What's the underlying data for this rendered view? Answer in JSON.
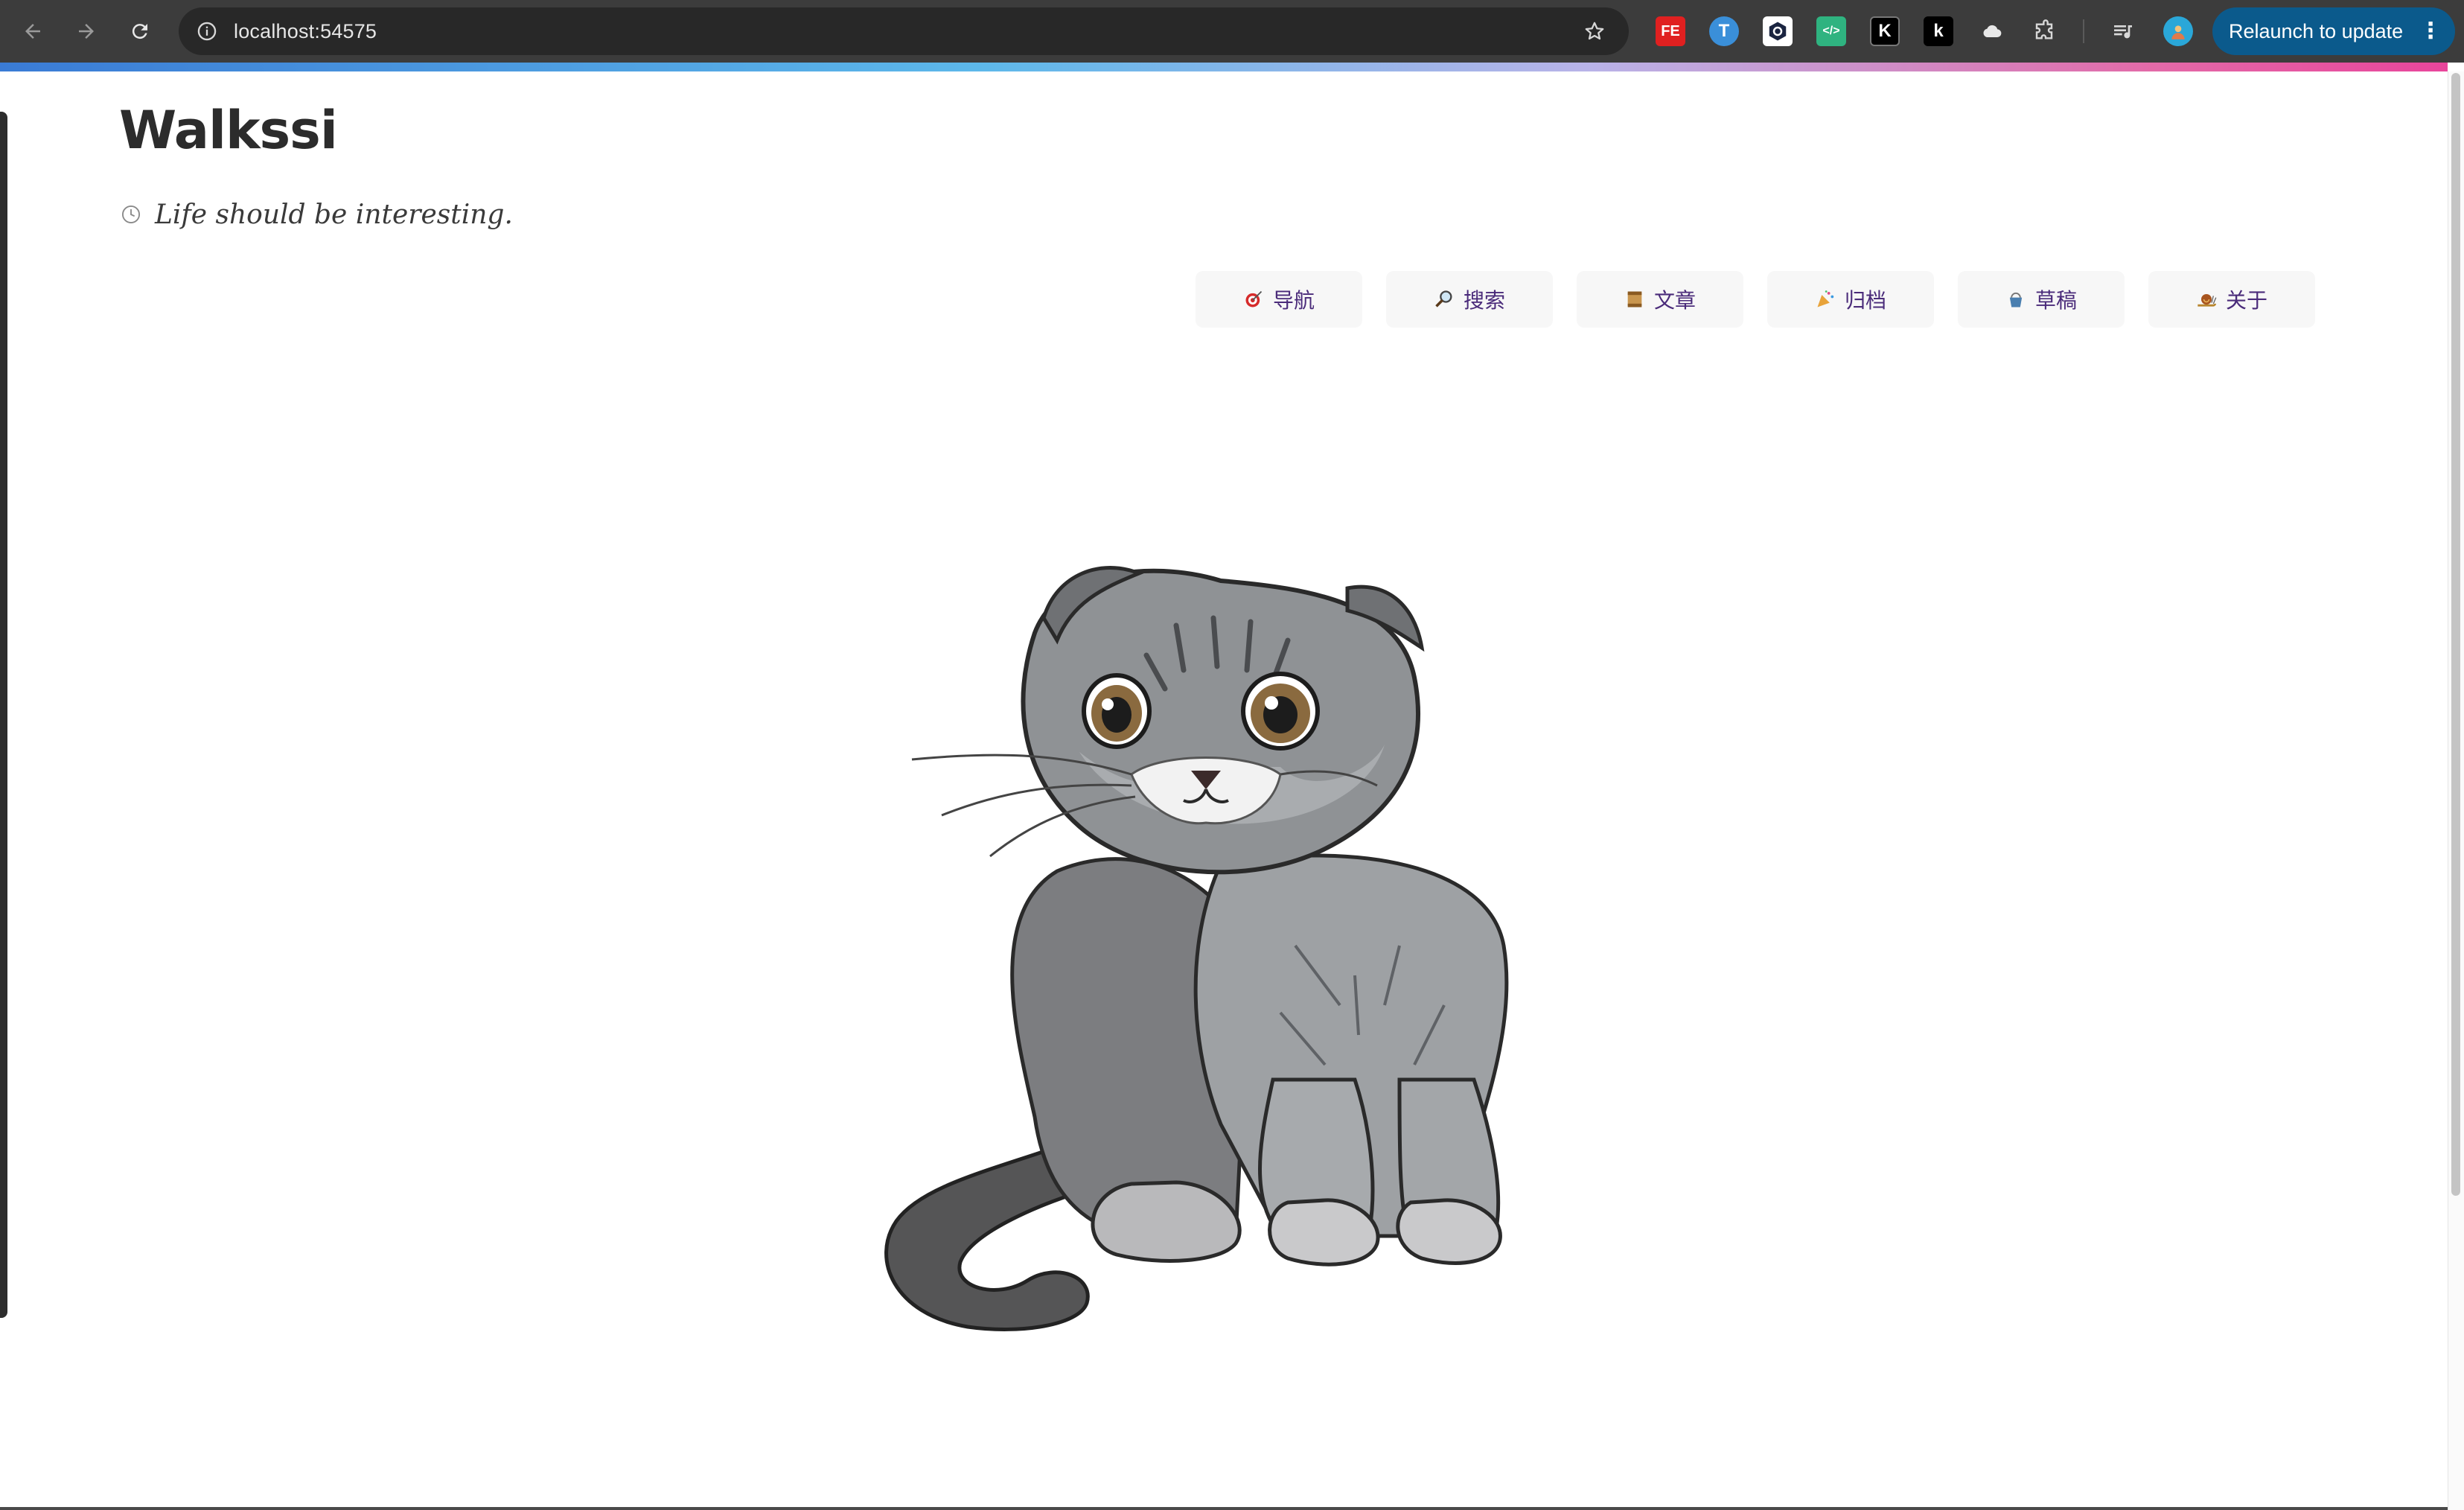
{
  "browser": {
    "url": "localhost:54575",
    "relaunch_label": "Relaunch to update",
    "extensions": [
      {
        "name": "fe-helper",
        "label": "FE",
        "color": "#e02020"
      },
      {
        "name": "translate",
        "label": "T",
        "color": "#3a8fd9"
      },
      {
        "name": "hex-tool",
        "label": "",
        "color": "#ffffff"
      },
      {
        "name": "code-viewer",
        "label": "</>",
        "color": "#2fb380"
      },
      {
        "name": "k-outline",
        "label": "K",
        "color": "#000000"
      },
      {
        "name": "k-solid",
        "label": "k",
        "color": "#000000"
      },
      {
        "name": "cloud",
        "label": "",
        "color": "#ffffff"
      }
    ]
  },
  "site": {
    "title": "Walkssi",
    "motto": "Life should be interesting."
  },
  "menu": [
    {
      "id": "nav",
      "emoji": "target-icon",
      "label": "导航"
    },
    {
      "id": "search",
      "emoji": "magnifier-icon",
      "label": "搜索"
    },
    {
      "id": "articles",
      "emoji": "scroll-icon",
      "label": "文章"
    },
    {
      "id": "archive",
      "emoji": "party-popper-icon",
      "label": "归档"
    },
    {
      "id": "drafts",
      "emoji": "bucket-icon",
      "label": "草稿"
    },
    {
      "id": "about",
      "emoji": "snail-icon",
      "label": "关于"
    }
  ],
  "colors": {
    "accent_text": "#4a2b7a",
    "relaunch_bg": "#0b5a8c",
    "chrome_bg": "#3c3c3c"
  }
}
